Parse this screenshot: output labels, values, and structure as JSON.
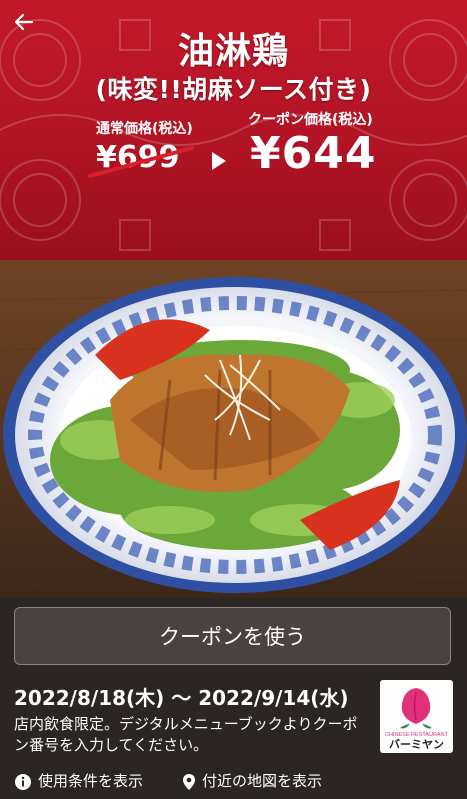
{
  "header": {
    "back_icon": "back-arrow-icon",
    "title": "油淋鶏",
    "subtitle": "(味変!!胡麻ソース付き)"
  },
  "price": {
    "regular_label": "通常価格(税込)",
    "regular_value": "¥699",
    "coupon_label": "クーポン価格(税込)",
    "coupon_value": "¥644"
  },
  "actions": {
    "use_coupon": "クーポンを使う",
    "terms": "使用条件を表示",
    "map": "付近の地図を表示"
  },
  "coupon": {
    "period": "2022/8/18(木) 〜 2022/9/14(水)",
    "note": "店内飲食限定。デジタルメニューブックよりクーポン番号を入力してください。"
  },
  "logo": {
    "line1": "CHINESE RESTAURANT",
    "line2": "バーミヤン"
  },
  "colors": {
    "hero_red": "#b11424",
    "panel_bg": "#2b2523",
    "strike_red": "#d8202a",
    "logo_pink": "#e2307a"
  }
}
